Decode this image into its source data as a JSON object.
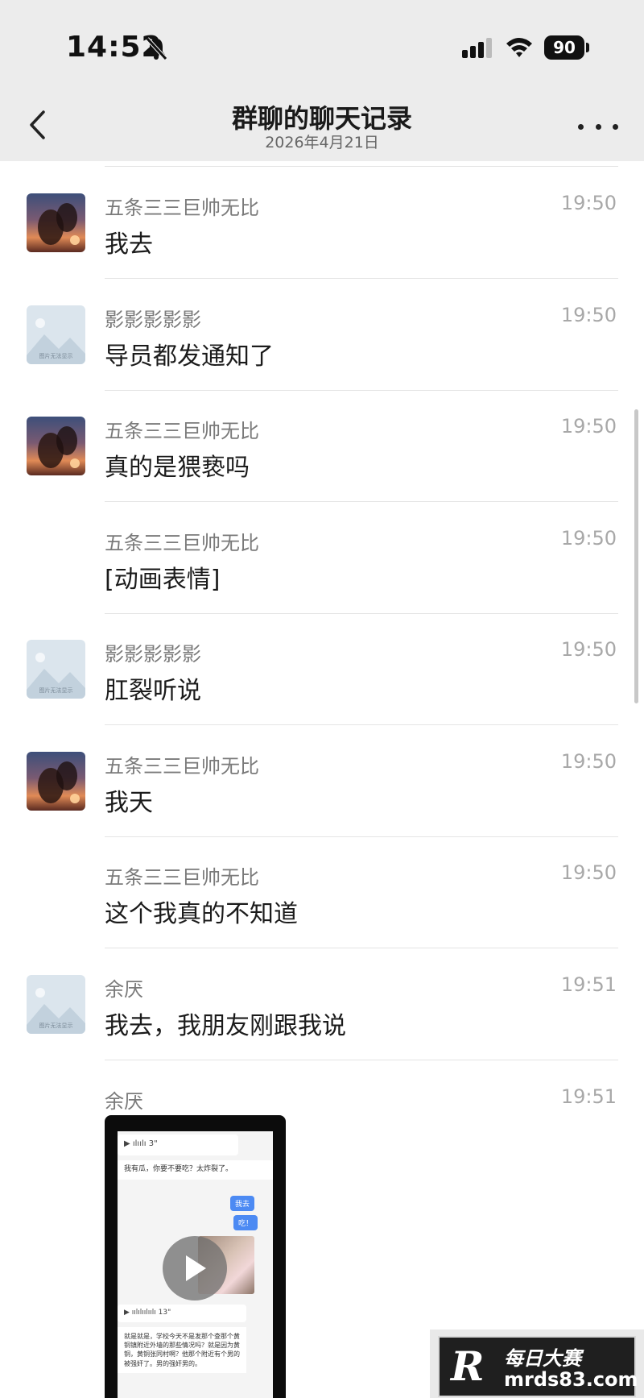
{
  "status_bar": {
    "time": "14:52",
    "battery": "90",
    "icons": [
      "bell-slash-icon",
      "signal-icon",
      "wifi-icon",
      "battery-icon"
    ]
  },
  "nav": {
    "title": "群聊的聊天记录",
    "subtitle": "2026年4月21日",
    "back_icon": "chevron-left-icon",
    "more_icon": "more-dots-icon"
  },
  "messages": [
    {
      "sender": "五条三三巨帅无比",
      "time": "19:50",
      "text": "我去",
      "avatar": "sunset"
    },
    {
      "sender": "影影影影影",
      "time": "19:50",
      "text": "导员都发通知了",
      "avatar": "placeholder"
    },
    {
      "sender": "五条三三巨帅无比",
      "time": "19:50",
      "text": "真的是猥亵吗",
      "avatar": "sunset"
    },
    {
      "sender": "五条三三巨帅无比",
      "time": "19:50",
      "text": "[动画表情]",
      "avatar": ""
    },
    {
      "sender": "影影影影影",
      "time": "19:50",
      "text": "肛裂听说",
      "avatar": "placeholder"
    },
    {
      "sender": "五条三三巨帅无比",
      "time": "19:50",
      "text": "我天",
      "avatar": "sunset"
    },
    {
      "sender": "五条三三巨帅无比",
      "time": "19:50",
      "text": "这个我真的不知道",
      "avatar": ""
    },
    {
      "sender": "余厌",
      "time": "19:51",
      "text": "我去，我朋友刚跟我说",
      "avatar": "placeholder"
    }
  ],
  "video_message": {
    "sender": "余厌",
    "time": "19:51",
    "thumbnail": {
      "voice1_duration": "3\"",
      "line1": "我有瓜，你要不要吃？太炸裂了。",
      "bubble1": "我去",
      "bubble2": "吃！",
      "voice2_duration": "13\"",
      "paragraph": "就是就是，学校今天不是发那个查那个黄铜镇附近外墙的那些情况吗？就是因为黄铜，黄铜张同村啊？他那个附近有个男的被强奸了。男的强奸男的。"
    },
    "play_icon": "play-icon"
  },
  "placeholder_avatar_caption": "图片无法显示",
  "watermark": {
    "brand": "每日大赛",
    "url": "mrds83.com",
    "logo_letter": "R"
  }
}
